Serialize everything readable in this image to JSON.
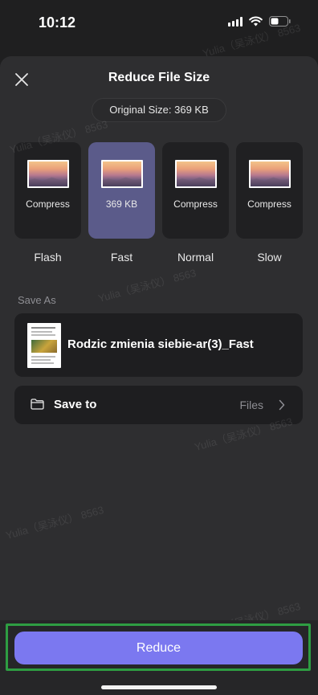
{
  "status": {
    "time": "10:12"
  },
  "header": {
    "title": "Reduce File Size"
  },
  "original_size": "Original Size: 369 KB",
  "options": [
    {
      "size": "Compress",
      "label": "Flash",
      "selected": false
    },
    {
      "size": "369 KB",
      "label": "Fast",
      "selected": true
    },
    {
      "size": "Compress",
      "label": "Normal",
      "selected": false
    },
    {
      "size": "Compress",
      "label": "Slow",
      "selected": false
    }
  ],
  "save_as": {
    "section_label": "Save As",
    "file_name": "Rodzic zmienia siebie-ar(3)_Fast"
  },
  "save_to": {
    "label": "Save to",
    "value": "Files"
  },
  "action": {
    "reduce_label": "Reduce"
  },
  "watermark": "Yulia（吴泳仪） 8563",
  "colors": {
    "background": "#1f1f20",
    "sheet": "#2e2e30",
    "selected_option": "#5b5b8a",
    "primary_button": "#7b78f0",
    "highlight": "#2e9d42"
  }
}
